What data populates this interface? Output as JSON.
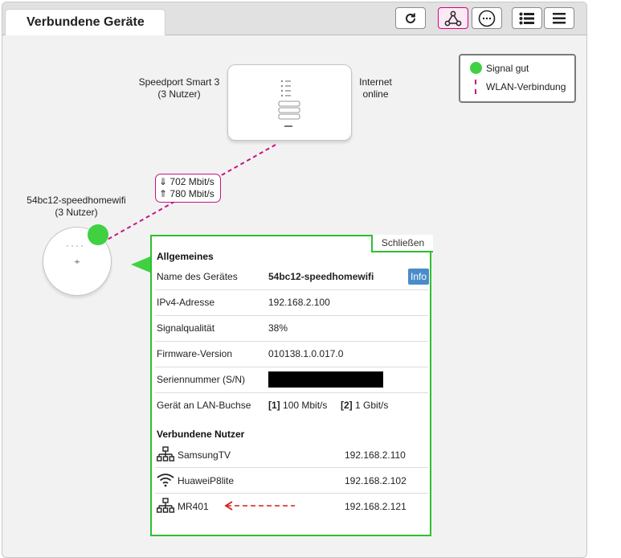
{
  "header": {
    "title": "Verbundene Geräte",
    "buttons": [
      {
        "name": "refresh-icon"
      },
      {
        "name": "network-topology-icon",
        "active": true
      },
      {
        "name": "more-options-icon"
      },
      {
        "name": "list-view-icon"
      },
      {
        "name": "menu-icon"
      }
    ]
  },
  "legend": {
    "signal_good": "Signal gut",
    "wlan_connection": "WLAN-Verbindung",
    "colors": {
      "signal": "#3fd142",
      "wlan": "#c6147e"
    }
  },
  "router": {
    "name": "Speedport Smart 3",
    "users": "(3 Nutzer)",
    "status_line1": "Internet",
    "status_line2": "online"
  },
  "link": {
    "down": "⇓ 702 Mbit/s",
    "up": "⇑ 780 Mbit/s"
  },
  "repeater": {
    "name": "54bc12-speedhomewifi",
    "users": "(3 Nutzer)"
  },
  "details": {
    "close_label": "Schließen",
    "general_title": "Allgemeines",
    "rows": [
      {
        "key": "Name des Gerätes",
        "value": "54bc12-speedhomewifi"
      },
      {
        "key": "IPv4-Adresse",
        "value": "192.168.2.100"
      },
      {
        "key": "Signalqualität",
        "value": "38%"
      },
      {
        "key": "Firmware-Version",
        "value": "010138.1.0.017.0"
      },
      {
        "key": "Seriennummer (S/N)",
        "value": ""
      },
      {
        "key": "Gerät an LAN-Buchse",
        "value": ""
      }
    ],
    "info_button": "Info",
    "lan_ports": [
      {
        "port": "[1]",
        "speed": "100 Mbit/s"
      },
      {
        "port": "[2]",
        "speed": "1 Gbit/s"
      }
    ],
    "users_title": "Verbundene Nutzer",
    "users": [
      {
        "name": "SamsungTV",
        "ip": "192.168.2.110",
        "icon": "lan-icon"
      },
      {
        "name": "HuaweiP8lite",
        "ip": "192.168.2.102",
        "icon": "wifi-icon"
      },
      {
        "name": "MR401",
        "ip": "192.168.2.121",
        "icon": "lan-icon"
      }
    ]
  }
}
